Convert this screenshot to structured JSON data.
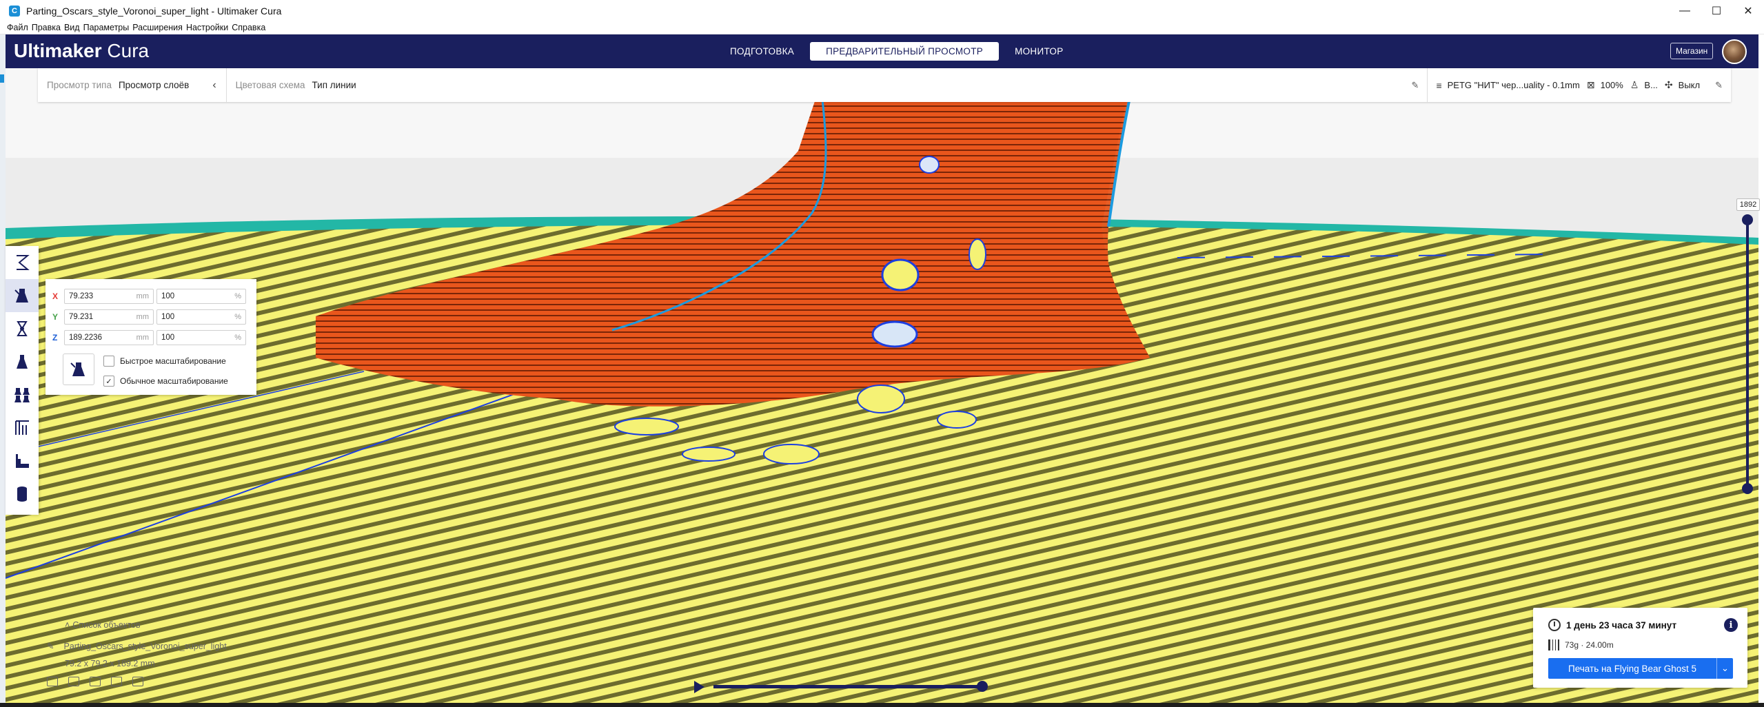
{
  "window": {
    "title": "Parting_Oscars_style_Voronoi_super_light - Ultimaker Cura",
    "app_icon": "C",
    "controls": {
      "minimize": "—",
      "maximize": "☐",
      "close": "✕"
    }
  },
  "menubar": [
    "Файл",
    "Правка",
    "Вид",
    "Параметры",
    "Расширения",
    "Настройки",
    "Справка"
  ],
  "header": {
    "brand_bold": "Ultimaker",
    "brand_light": "Cura",
    "stages": [
      {
        "label": "ПОДГОТОВКА",
        "active": false
      },
      {
        "label": "ПРЕДВАРИТЕЛЬНЫЙ ПРОСМОТР",
        "active": true
      },
      {
        "label": "МОНИТОР",
        "active": false
      }
    ],
    "store_label": "Магазин"
  },
  "view_settings": {
    "view_type_label": "Просмотр типа",
    "view_type_value": "Просмотр слоёв",
    "color_scheme_label": "Цветовая схема",
    "color_scheme_value": "Тип линии",
    "profile": "PETG \"НИТ\" чер...uality - 0.1mm",
    "infill": "100%",
    "support": "В...",
    "adhesion": "Выкл"
  },
  "scale_panel": {
    "x": {
      "axis": "X",
      "value": "79.233",
      "unit": "mm",
      "percent": "100",
      "percent_unit": "%",
      "color": "#e53935"
    },
    "y": {
      "axis": "Y",
      "value": "79.231",
      "unit": "mm",
      "percent": "100",
      "percent_unit": "%",
      "color": "#43a047"
    },
    "z": {
      "axis": "Z",
      "value": "189.2236",
      "unit": "mm",
      "percent": "100",
      "percent_unit": "%",
      "color": "#1e5fd6"
    },
    "snap_scaling": {
      "label": "Быстрое масштабирование",
      "checked": false
    },
    "uniform_scaling": {
      "label": "Обычное масштабирование",
      "checked": true,
      "mark": "✓"
    }
  },
  "layer_slider": {
    "current_layer": "1892"
  },
  "object_list": {
    "header": "Список объектов",
    "object_name": "Parting_Oscars_style_Voronoi_super_light",
    "dimensions": "79.2 x 79.2 x 189.2 mm"
  },
  "print_panel": {
    "time": "1 день 23 часа 37 минут",
    "material": "73g · 24.00m",
    "button_label": "Печать на Flying Bear Ghost 5",
    "info_glyph": "i"
  },
  "colors": {
    "header_bg": "#1a1f5e",
    "accent_blue": "#196ef0",
    "model_orange": "#e9561c",
    "bed_yellow": "#f5f275",
    "skirt_teal": "#23b7a6",
    "travel_blue": "#1c3fe0"
  }
}
